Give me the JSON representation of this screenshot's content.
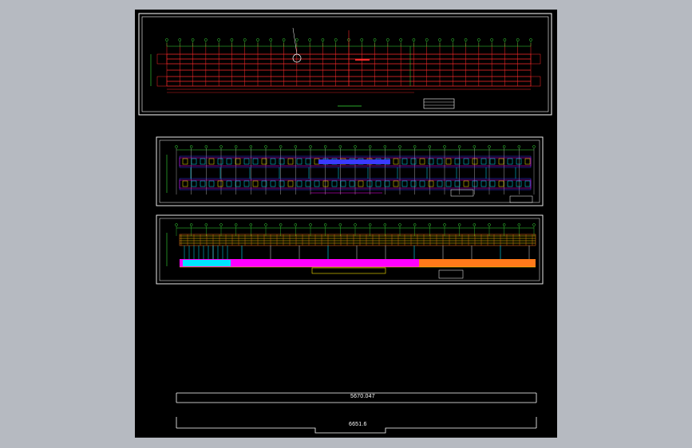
{
  "viewport": {
    "background": "#b6bac1",
    "canvas_background": "#000000"
  },
  "dimensions": {
    "overall_width_upper": "5670.047",
    "overall_width_lower": "6651.6"
  },
  "colors": {
    "frame": "#ffffff",
    "grid_red": "#ff2a2a",
    "axis_green": "#39e039",
    "cyan": "#00e5ff",
    "yellow": "#ffe600",
    "magenta": "#ff00ff",
    "blue": "#3a3aff",
    "orange": "#ff7a1a"
  }
}
